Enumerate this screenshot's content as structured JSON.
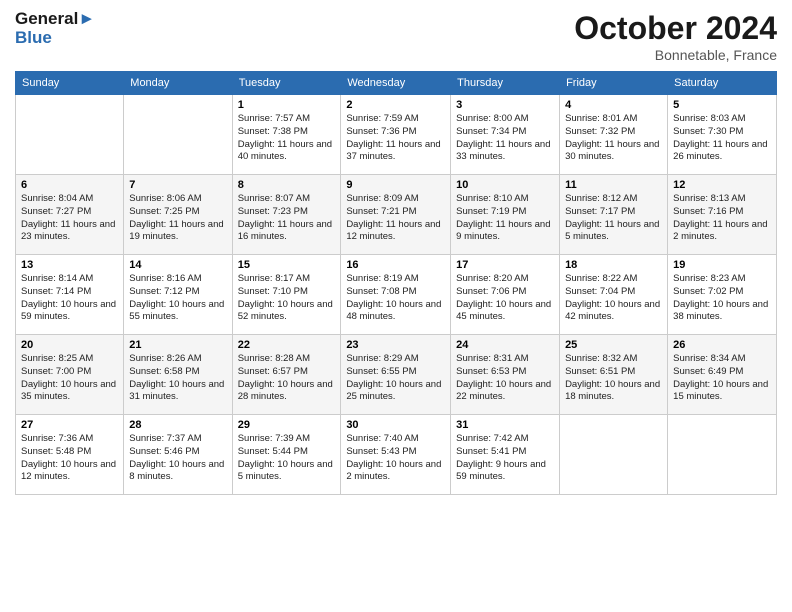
{
  "header": {
    "logo_line1": "General",
    "logo_line2": "Blue",
    "month_title": "October 2024",
    "location": "Bonnetable, France"
  },
  "days_of_week": [
    "Sunday",
    "Monday",
    "Tuesday",
    "Wednesday",
    "Thursday",
    "Friday",
    "Saturday"
  ],
  "weeks": [
    [
      {
        "day": "",
        "info": ""
      },
      {
        "day": "",
        "info": ""
      },
      {
        "day": "1",
        "info": "Sunrise: 7:57 AM\nSunset: 7:38 PM\nDaylight: 11 hours and 40 minutes."
      },
      {
        "day": "2",
        "info": "Sunrise: 7:59 AM\nSunset: 7:36 PM\nDaylight: 11 hours and 37 minutes."
      },
      {
        "day": "3",
        "info": "Sunrise: 8:00 AM\nSunset: 7:34 PM\nDaylight: 11 hours and 33 minutes."
      },
      {
        "day": "4",
        "info": "Sunrise: 8:01 AM\nSunset: 7:32 PM\nDaylight: 11 hours and 30 minutes."
      },
      {
        "day": "5",
        "info": "Sunrise: 8:03 AM\nSunset: 7:30 PM\nDaylight: 11 hours and 26 minutes."
      }
    ],
    [
      {
        "day": "6",
        "info": "Sunrise: 8:04 AM\nSunset: 7:27 PM\nDaylight: 11 hours and 23 minutes."
      },
      {
        "day": "7",
        "info": "Sunrise: 8:06 AM\nSunset: 7:25 PM\nDaylight: 11 hours and 19 minutes."
      },
      {
        "day": "8",
        "info": "Sunrise: 8:07 AM\nSunset: 7:23 PM\nDaylight: 11 hours and 16 minutes."
      },
      {
        "day": "9",
        "info": "Sunrise: 8:09 AM\nSunset: 7:21 PM\nDaylight: 11 hours and 12 minutes."
      },
      {
        "day": "10",
        "info": "Sunrise: 8:10 AM\nSunset: 7:19 PM\nDaylight: 11 hours and 9 minutes."
      },
      {
        "day": "11",
        "info": "Sunrise: 8:12 AM\nSunset: 7:17 PM\nDaylight: 11 hours and 5 minutes."
      },
      {
        "day": "12",
        "info": "Sunrise: 8:13 AM\nSunset: 7:16 PM\nDaylight: 11 hours and 2 minutes."
      }
    ],
    [
      {
        "day": "13",
        "info": "Sunrise: 8:14 AM\nSunset: 7:14 PM\nDaylight: 10 hours and 59 minutes."
      },
      {
        "day": "14",
        "info": "Sunrise: 8:16 AM\nSunset: 7:12 PM\nDaylight: 10 hours and 55 minutes."
      },
      {
        "day": "15",
        "info": "Sunrise: 8:17 AM\nSunset: 7:10 PM\nDaylight: 10 hours and 52 minutes."
      },
      {
        "day": "16",
        "info": "Sunrise: 8:19 AM\nSunset: 7:08 PM\nDaylight: 10 hours and 48 minutes."
      },
      {
        "day": "17",
        "info": "Sunrise: 8:20 AM\nSunset: 7:06 PM\nDaylight: 10 hours and 45 minutes."
      },
      {
        "day": "18",
        "info": "Sunrise: 8:22 AM\nSunset: 7:04 PM\nDaylight: 10 hours and 42 minutes."
      },
      {
        "day": "19",
        "info": "Sunrise: 8:23 AM\nSunset: 7:02 PM\nDaylight: 10 hours and 38 minutes."
      }
    ],
    [
      {
        "day": "20",
        "info": "Sunrise: 8:25 AM\nSunset: 7:00 PM\nDaylight: 10 hours and 35 minutes."
      },
      {
        "day": "21",
        "info": "Sunrise: 8:26 AM\nSunset: 6:58 PM\nDaylight: 10 hours and 31 minutes."
      },
      {
        "day": "22",
        "info": "Sunrise: 8:28 AM\nSunset: 6:57 PM\nDaylight: 10 hours and 28 minutes."
      },
      {
        "day": "23",
        "info": "Sunrise: 8:29 AM\nSunset: 6:55 PM\nDaylight: 10 hours and 25 minutes."
      },
      {
        "day": "24",
        "info": "Sunrise: 8:31 AM\nSunset: 6:53 PM\nDaylight: 10 hours and 22 minutes."
      },
      {
        "day": "25",
        "info": "Sunrise: 8:32 AM\nSunset: 6:51 PM\nDaylight: 10 hours and 18 minutes."
      },
      {
        "day": "26",
        "info": "Sunrise: 8:34 AM\nSunset: 6:49 PM\nDaylight: 10 hours and 15 minutes."
      }
    ],
    [
      {
        "day": "27",
        "info": "Sunrise: 7:36 AM\nSunset: 5:48 PM\nDaylight: 10 hours and 12 minutes."
      },
      {
        "day": "28",
        "info": "Sunrise: 7:37 AM\nSunset: 5:46 PM\nDaylight: 10 hours and 8 minutes."
      },
      {
        "day": "29",
        "info": "Sunrise: 7:39 AM\nSunset: 5:44 PM\nDaylight: 10 hours and 5 minutes."
      },
      {
        "day": "30",
        "info": "Sunrise: 7:40 AM\nSunset: 5:43 PM\nDaylight: 10 hours and 2 minutes."
      },
      {
        "day": "31",
        "info": "Sunrise: 7:42 AM\nSunset: 5:41 PM\nDaylight: 9 hours and 59 minutes."
      },
      {
        "day": "",
        "info": ""
      },
      {
        "day": "",
        "info": ""
      }
    ]
  ]
}
